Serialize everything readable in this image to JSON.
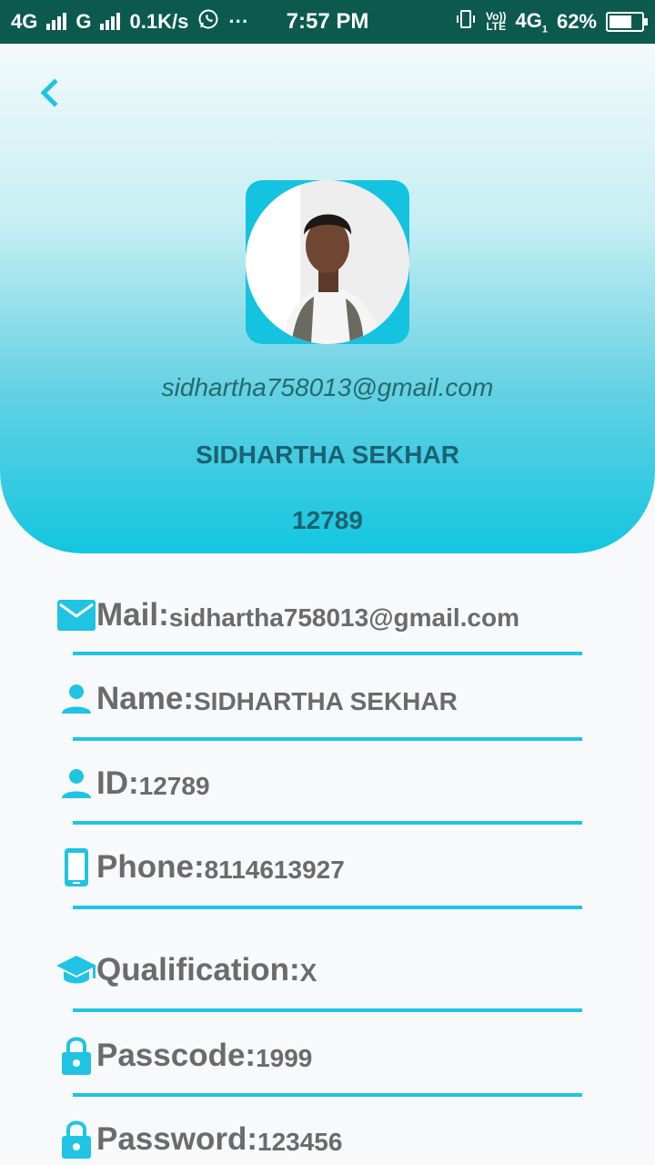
{
  "status_bar": {
    "network1": "4G",
    "network2": "G",
    "speed": "0.1K/s",
    "more": "···",
    "time": "7:57 PM",
    "volte_top": "Vo))",
    "volte_bottom": "LTE",
    "network3": "4G",
    "sim_index": "1",
    "battery": "62%"
  },
  "profile": {
    "email": "sidhartha758013@gmail.com",
    "name": "SIDHARTHA SEKHAR",
    "id": "12789"
  },
  "details": [
    {
      "icon": "mail-icon",
      "label": "Mail:",
      "value": "sidhartha758013@gmail.com"
    },
    {
      "icon": "person-icon",
      "label": "Name:",
      "value": "SIDHARTHA SEKHAR"
    },
    {
      "icon": "person-icon",
      "label": "ID:",
      "value": "12789"
    },
    {
      "icon": "phone-icon",
      "label": "Phone:",
      "value": "8114613927"
    },
    {
      "icon": "graduation-cap-icon",
      "label": "Qualification:",
      "value": "X"
    },
    {
      "icon": "lock-icon",
      "label": "Passcode:",
      "value": "1999"
    },
    {
      "icon": "lock-icon",
      "label": "Password:",
      "value": "123456"
    }
  ],
  "colors": {
    "accent": "#1fc4e2",
    "status_bar": "#0b5a4d",
    "text": "#6b6b6b"
  }
}
